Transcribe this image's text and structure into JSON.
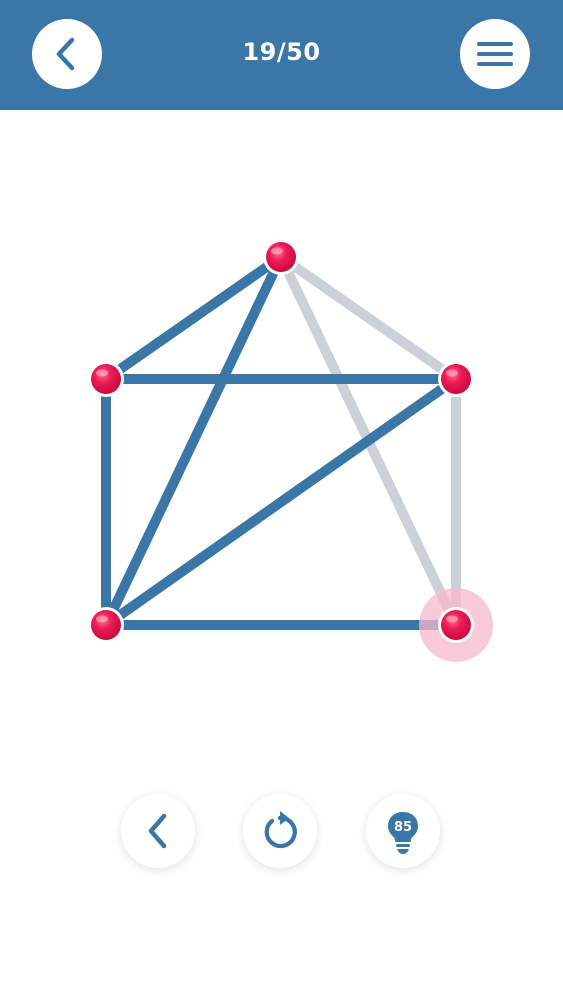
{
  "header": {
    "level_text": "19/50",
    "back_icon": "chevron-left-icon",
    "menu_icon": "hamburger-menu-icon"
  },
  "puzzle": {
    "colors": {
      "drawn_edge": "#3a76a6",
      "undrawn_edge": "#ccd0d8",
      "node": "#e8134f",
      "active_glow": "#f7b8cb"
    },
    "nodes": [
      "top",
      "left-mid",
      "right-mid",
      "bottom-left",
      "bottom-right"
    ],
    "active_node": "bottom-right",
    "edges": [
      {
        "from": "top",
        "to": "left-mid",
        "drawn": true
      },
      {
        "from": "top",
        "to": "bottom-left",
        "drawn": true
      },
      {
        "from": "left-mid",
        "to": "right-mid",
        "drawn": true
      },
      {
        "from": "left-mid",
        "to": "bottom-left",
        "drawn": true
      },
      {
        "from": "right-mid",
        "to": "bottom-left",
        "drawn": true
      },
      {
        "from": "bottom-left",
        "to": "bottom-right",
        "drawn": true
      },
      {
        "from": "top",
        "to": "right-mid",
        "drawn": false
      },
      {
        "from": "top",
        "to": "bottom-right",
        "drawn": false
      },
      {
        "from": "right-mid",
        "to": "bottom-right",
        "drawn": false
      }
    ]
  },
  "controls": {
    "undo_icon": "chevron-left-icon",
    "restart_icon": "restart-icon",
    "hint_icon": "lightbulb-icon",
    "hint_count": "85"
  }
}
